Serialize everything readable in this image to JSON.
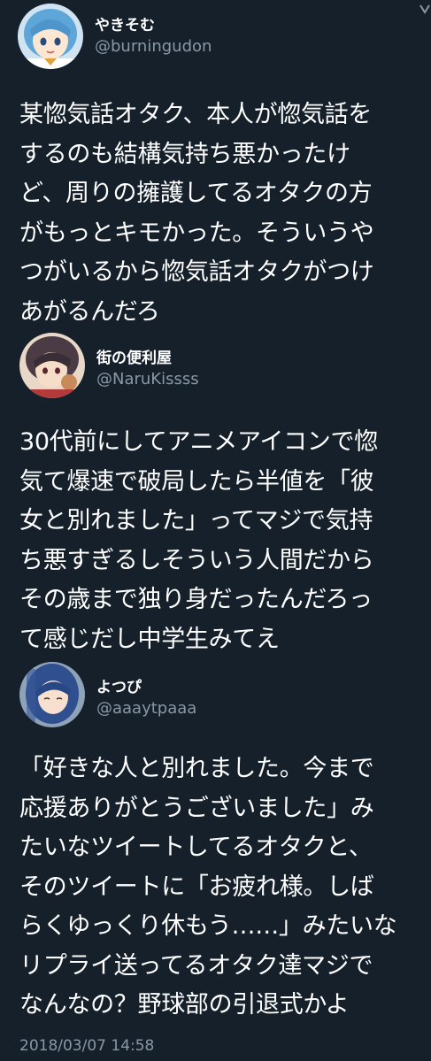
{
  "tweets": [
    {
      "display_name": "やきそむ",
      "handle": "@burningudon",
      "lines": [
        "某惚気話オタク、本人が惚気話を",
        "するのも結構気持ち悪かったけ",
        "ど、周りの擁護してるオタクの方",
        "がもっとキモかった。そういうや",
        "つがいるから惚気話オタクがつけ",
        "あがるんだろ"
      ]
    },
    {
      "display_name": "街の便利屋",
      "handle": "@NaruKissss",
      "lines": [
        "30代前にしてアニメアイコンで惚",
        "気て爆速で破局したら半値を「彼",
        "女と別れました」ってマジで気持",
        "ち悪すぎるしそういう人間だから",
        "その歳まで独り身だったんだろっ",
        "て感じだし中学生みてえ"
      ]
    },
    {
      "display_name": "よつぴ",
      "handle": "@aaaytpaaa",
      "lines": [
        "「好きな人と別れました。今まで",
        "応援ありがとうございました」み",
        "たいなツイートしてるオタクと、",
        "そのツイートに「お疲れ様。しば",
        "らくゆっくり休もう……」みたいな",
        "リプライ送ってるオタク達マジで",
        "なんなの？野球部の引退式かよ"
      ],
      "timestamp": "2018/03/07 14:58"
    }
  ],
  "icons": {
    "avatar_1": "anime-girl-blue-hair-avatar",
    "avatar_2": "anime-character-dark-hair-avatar",
    "avatar_3": "anime-girl-blue-long-hair-avatar",
    "more": "more-options-icon"
  },
  "colors": {
    "background": "#15202b",
    "text": "#ffffff",
    "secondary_text": "#8899a6"
  }
}
